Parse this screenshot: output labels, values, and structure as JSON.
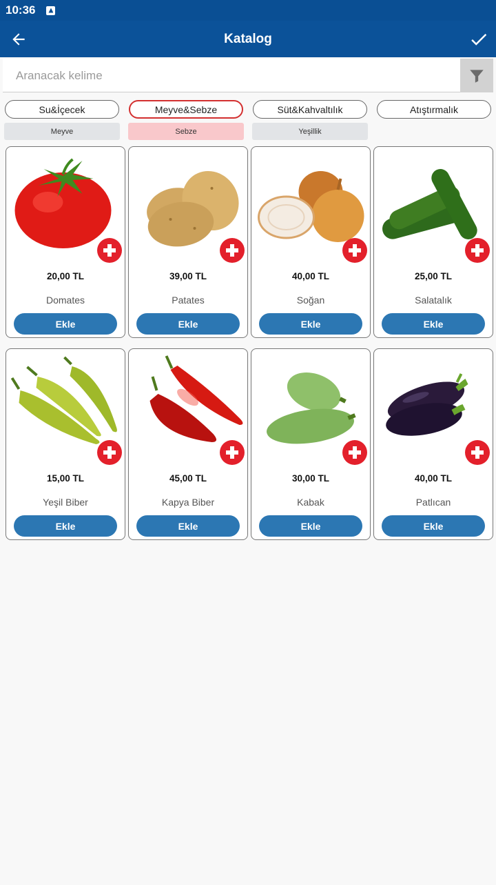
{
  "status_bar": {
    "time": "10:36"
  },
  "app_bar": {
    "title": "Katalog"
  },
  "search": {
    "placeholder": "Aranacak kelime"
  },
  "categories": [
    {
      "label": "Su&İçecek",
      "active": false
    },
    {
      "label": "Meyve&Sebze",
      "active": true
    },
    {
      "label": "Süt&Kahvaltılık",
      "active": false
    },
    {
      "label": "Atıştırmalık",
      "active": false
    }
  ],
  "subcategories": [
    {
      "label": "Meyve",
      "active": false
    },
    {
      "label": "Sebze",
      "active": true
    },
    {
      "label": "Yeşillik",
      "active": false
    }
  ],
  "products": [
    {
      "name": "Domates",
      "price": "20,00 TL",
      "icon": "tomato-icon",
      "button": "Ekle"
    },
    {
      "name": "Patates",
      "price": "39,00 TL",
      "icon": "potato-icon",
      "button": "Ekle"
    },
    {
      "name": "Soğan",
      "price": "40,00 TL",
      "icon": "onion-icon",
      "button": "Ekle"
    },
    {
      "name": "Salatalık",
      "price": "25,00 TL",
      "icon": "cucumber-icon",
      "button": "Ekle"
    },
    {
      "name": "Yeşil Biber",
      "price": "15,00 TL",
      "icon": "green-pepper-icon",
      "button": "Ekle"
    },
    {
      "name": "Kapya Biber",
      "price": "45,00 TL",
      "icon": "red-pepper-icon",
      "button": "Ekle"
    },
    {
      "name": "Kabak",
      "price": "30,00 TL",
      "icon": "zucchini-icon",
      "button": "Ekle"
    },
    {
      "name": "Patlıcan",
      "price": "40,00 TL",
      "icon": "eggplant-icon",
      "button": "Ekle"
    }
  ],
  "colors": {
    "primary": "#0b5299",
    "accent_red": "#e3202b",
    "button_blue": "#2c77b3",
    "active_sub": "#f9c8cb"
  }
}
